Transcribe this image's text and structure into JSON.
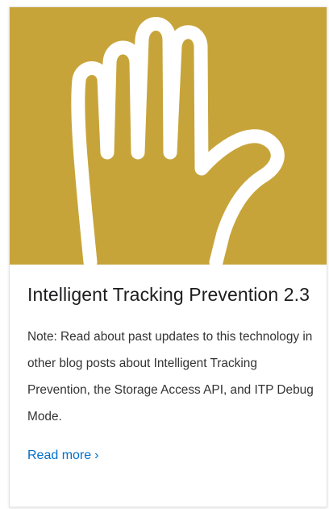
{
  "card": {
    "hero": {
      "icon": "raised-hand-icon",
      "background_color": "#c7a43a",
      "icon_color": "#ffffff"
    },
    "title": "Intelligent Tracking Prevention 2.3",
    "description": "Note: Read about past updates to this technology in other blog posts about Intelligent Tracking Prevention, the Storage Access API, and ITP Debug Mode.",
    "read_more": {
      "label": "Read more",
      "chevron": "›",
      "color": "#0070c9"
    }
  }
}
